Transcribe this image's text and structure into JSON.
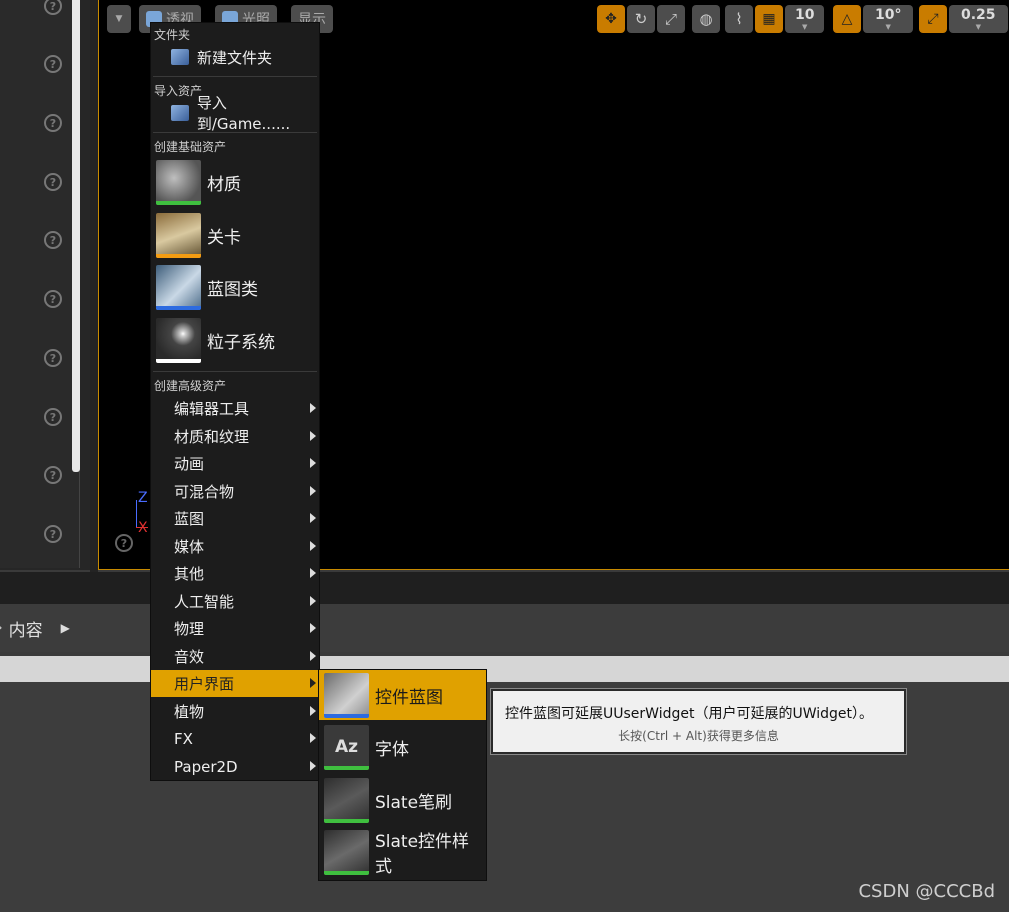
{
  "viewport": {
    "buttons": [
      {
        "icon": "perspective-icon",
        "label": "透视"
      },
      {
        "icon": "lighting-icon",
        "label": "光照"
      },
      {
        "icon": "show-icon",
        "label": "显示"
      }
    ],
    "grid_snap": "10",
    "rotation_snap": "10°",
    "scale_snap": "0.25",
    "axis_z": "Z",
    "axis_x": "X"
  },
  "content_bar": {
    "label": "内容"
  },
  "menu": {
    "section_folder": "文件夹",
    "new_folder": "新建文件夹",
    "section_import": "导入资产",
    "import_to": "导入到/Game......",
    "section_basic": "创建基础资产",
    "basic_items": [
      {
        "label": "材质",
        "icon": "material-icon",
        "bar_color": "#3fbf3f"
      },
      {
        "label": "关卡",
        "icon": "level-icon",
        "bar_color": "#f39c12"
      },
      {
        "label": "蓝图类",
        "icon": "blueprint-class-icon",
        "bar_color": "#2d6be0"
      },
      {
        "label": "粒子系统",
        "icon": "particle-system-icon",
        "bar_color": "#ffffff"
      }
    ],
    "section_advanced": "创建高级资产",
    "advanced_items": [
      "编辑器工具",
      "材质和纹理",
      "动画",
      "可混合物",
      "蓝图",
      "媒体",
      "其他",
      "人工智能",
      "物理",
      "音效",
      "用户界面",
      "植物",
      "FX",
      "Paper2D"
    ],
    "active_item": "用户界面"
  },
  "submenu": {
    "items": [
      {
        "label": "控件蓝图",
        "icon": "widget-blueprint-icon",
        "bar_color": "#2d6be0"
      },
      {
        "label": "字体",
        "icon": "font-icon",
        "bar_color": "#3fbf3f"
      },
      {
        "label": "Slate笔刷",
        "icon": "slate-brush-icon",
        "bar_color": "#3fbf3f"
      },
      {
        "label": "Slate控件样式",
        "icon": "slate-widget-style-icon",
        "bar_color": "#3fbf3f"
      }
    ]
  },
  "tooltip": {
    "line1": "控件蓝图可延展UUserWidget（用户可延展的UWidget）。",
    "line2": "长按(Ctrl + Alt)获得更多信息"
  },
  "watermark": "CSDN @CCCBd"
}
